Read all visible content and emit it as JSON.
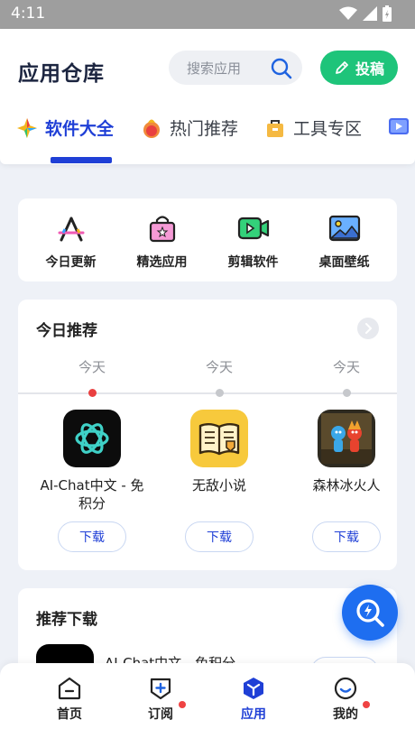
{
  "status_bar": {
    "time": "4:11"
  },
  "header": {
    "title": "应用仓库",
    "search_placeholder": "搜索应用",
    "submit_label": "投稿"
  },
  "tabs": [
    {
      "label": "软件大全",
      "active": true
    },
    {
      "label": "热门推荐",
      "active": false
    },
    {
      "label": "工具专区",
      "active": false
    }
  ],
  "quick_links": [
    {
      "label": "今日更新",
      "icon": "appstore-icon"
    },
    {
      "label": "精选应用",
      "icon": "shopping-bag-icon"
    },
    {
      "label": "剪辑软件",
      "icon": "video-camera-icon"
    },
    {
      "label": "桌面壁纸",
      "icon": "image-icon"
    }
  ],
  "today_recommend": {
    "title": "今日推荐",
    "items": [
      {
        "day": "今天",
        "name": "AI-Chat中文 - 免积分",
        "button": "下载",
        "active": true
      },
      {
        "day": "今天",
        "name": "无敌小说",
        "button": "下载",
        "active": false
      },
      {
        "day": "今天",
        "name": "森林冰火人",
        "button": "下载",
        "active": false
      }
    ]
  },
  "recommend_download": {
    "title": "推荐下载",
    "first_item_name": "AI-Chat中文 - 免积分"
  },
  "bottom_nav": [
    {
      "label": "首页",
      "active": false,
      "badge": false
    },
    {
      "label": "订阅",
      "active": false,
      "badge": true
    },
    {
      "label": "应用",
      "active": true,
      "badge": false
    },
    {
      "label": "我的",
      "active": false,
      "badge": true
    }
  ],
  "colors": {
    "accent": "#1f3fd6",
    "submit_green": "#1ec47a",
    "fab_blue": "#1e6ef0",
    "badge_red": "#ef4343"
  }
}
